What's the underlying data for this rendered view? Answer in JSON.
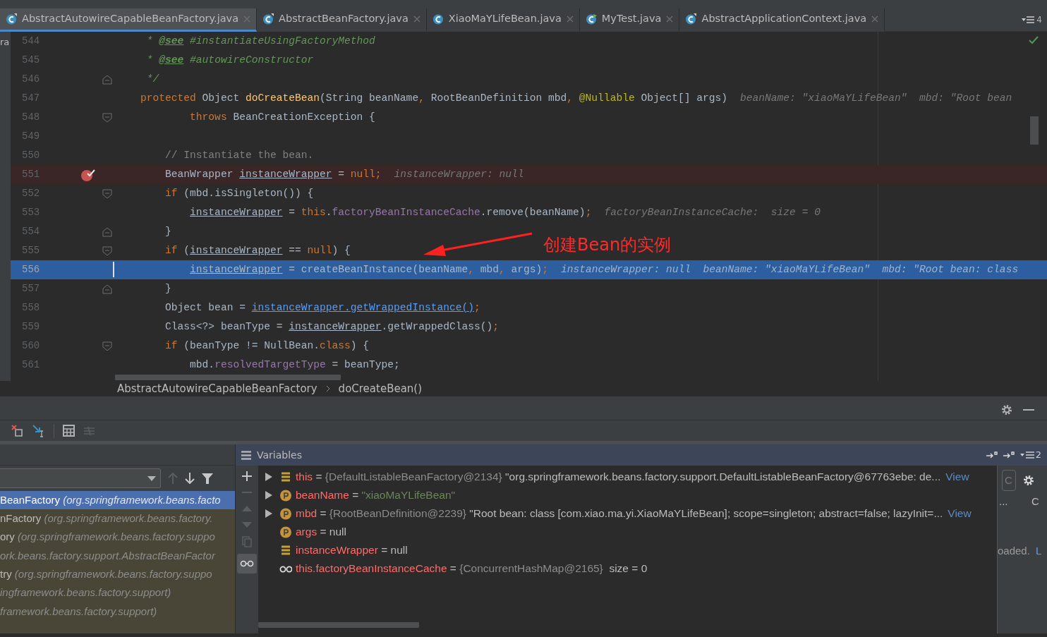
{
  "left_edge_text": "ra",
  "tabs": [
    {
      "label": "AbstractAutowireCapableBeanFactory.java",
      "kind": "abstract",
      "selected": true
    },
    {
      "label": "AbstractBeanFactory.java",
      "kind": "abstract",
      "selected": false
    },
    {
      "label": "XiaoMaYLifeBean.java",
      "kind": "class",
      "selected": false
    },
    {
      "label": "MyTest.java",
      "kind": "test",
      "selected": false
    },
    {
      "label": "AbstractApplicationContext.java",
      "kind": "abstract",
      "selected": false
    }
  ],
  "tab_count": "4",
  "editor": {
    "lines": [
      {
        "number": "544",
        "segments": [
          {
            "kind": "doc",
            "t": "     * "
          },
          {
            "kind": "tag",
            "t": "@see"
          },
          {
            "kind": "doc",
            "t": " #instantiateUsingFactoryMethod"
          }
        ]
      },
      {
        "number": "545",
        "segments": [
          {
            "kind": "doc",
            "t": "     * "
          },
          {
            "kind": "tag",
            "t": "@see"
          },
          {
            "kind": "doc",
            "t": " #autowireConstructor"
          }
        ]
      },
      {
        "number": "546",
        "fold_end": true,
        "segments": [
          {
            "kind": "doc",
            "t": "     */"
          }
        ]
      },
      {
        "number": "547",
        "segments": [
          {
            "kind": "kw",
            "t": "    protected "
          },
          {
            "kind": "plain",
            "t": "Object "
          },
          {
            "kind": "fn",
            "t": "doCreateBean"
          },
          {
            "kind": "plain",
            "t": "(String beanName"
          },
          {
            "kind": "kw",
            "t": ", "
          },
          {
            "kind": "plain",
            "t": "RootBeanDefinition mbd"
          },
          {
            "kind": "kw",
            "t": ", "
          },
          {
            "kind": "ann",
            "t": "@Nullable "
          },
          {
            "kind": "plain",
            "t": "Object[] args)"
          }
        ],
        "hint": "beanName: \"xiaoMaYLifeBean\"  mbd: \"Root bean"
      },
      {
        "number": "548",
        "fold_start": true,
        "segments": [
          {
            "kind": "kw",
            "t": "            throws "
          },
          {
            "kind": "plain",
            "t": "BeanCreationException {"
          }
        ]
      },
      {
        "number": "549"
      },
      {
        "number": "550",
        "segments": [
          {
            "kind": "cm",
            "t": "        // Instantiate the bean."
          }
        ]
      },
      {
        "number": "551",
        "breakpoint": true,
        "segments": [
          {
            "kind": "plain",
            "t": "        BeanWrapper "
          },
          {
            "kind": "ul",
            "t": "instanceWrapper"
          },
          {
            "kind": "plain",
            "t": " = "
          },
          {
            "kind": "kw",
            "t": "null;"
          }
        ],
        "hint": "instanceWrapper: null"
      },
      {
        "number": "552",
        "fold_start": true,
        "segments": [
          {
            "kind": "kw",
            "t": "        if "
          },
          {
            "kind": "plain",
            "t": "(mbd.isSingleton()) {"
          }
        ]
      },
      {
        "number": "553",
        "segments": [
          {
            "kind": "ul",
            "t": "            instanceWrapper"
          },
          {
            "kind": "plain",
            "t": " = "
          },
          {
            "kind": "kw",
            "t": "this"
          },
          {
            "kind": "plain",
            "t": "."
          },
          {
            "kind": "field",
            "t": "factoryBeanInstanceCache"
          },
          {
            "kind": "plain",
            "t": ".remove(beanName)"
          },
          {
            "kind": "kw",
            "t": ";"
          }
        ],
        "hint": "factoryBeanInstanceCache:  size = 0"
      },
      {
        "number": "554",
        "fold_end": true,
        "segments": [
          {
            "kind": "plain",
            "t": "        }"
          }
        ]
      },
      {
        "number": "555",
        "fold_start": true,
        "segments": [
          {
            "kind": "kw",
            "t": "        if "
          },
          {
            "kind": "plain",
            "t": "("
          },
          {
            "kind": "ul",
            "t": "instanceWrapper"
          },
          {
            "kind": "plain",
            "t": " == "
          },
          {
            "kind": "kw",
            "t": "null"
          },
          {
            "kind": "plain",
            "t": ") {"
          }
        ]
      },
      {
        "number": "556",
        "current": true,
        "segments": [
          {
            "kind": "ul",
            "t": "            instanceWrapper"
          },
          {
            "kind": "plain",
            "t": " = createBeanInstance(beanName"
          },
          {
            "kind": "kw",
            "t": ", "
          },
          {
            "kind": "plain",
            "t": "mbd"
          },
          {
            "kind": "kw",
            "t": ", "
          },
          {
            "kind": "plain",
            "t": "args)"
          },
          {
            "kind": "kw",
            "t": ";"
          }
        ],
        "hint": "instanceWrapper: null  beanName: \"xiaoMaYLifeBean\"  mbd: \"Root bean: class"
      },
      {
        "number": "557",
        "fold_end": true,
        "segments": [
          {
            "kind": "plain",
            "t": "        }"
          }
        ]
      },
      {
        "number": "558",
        "segments": [
          {
            "kind": "plain",
            "t": "        Object bean = "
          },
          {
            "kind": "link",
            "t": "instanceWrapper.getWrappedInstance()"
          },
          {
            "kind": "kw",
            "t": ";"
          }
        ]
      },
      {
        "number": "559",
        "segments": [
          {
            "kind": "plain",
            "t": "        Class<?> beanType = "
          },
          {
            "kind": "ul",
            "t": "instanceWrapper"
          },
          {
            "kind": "plain",
            "t": ".getWrappedClass()"
          },
          {
            "kind": "kw",
            "t": ";"
          }
        ]
      },
      {
        "number": "560",
        "fold_start": true,
        "segments": [
          {
            "kind": "kw",
            "t": "        if "
          },
          {
            "kind": "plain",
            "t": "(beanType != NullBean."
          },
          {
            "kind": "kw",
            "t": "class"
          },
          {
            "kind": "plain",
            "t": ") {"
          }
        ]
      },
      {
        "number": "561",
        "segments": [
          {
            "kind": "plain",
            "t": "            mbd."
          },
          {
            "kind": "field",
            "t": "resolvedTargetType"
          },
          {
            "kind": "plain",
            "t": " = beanType;"
          }
        ]
      }
    ],
    "annotation": "创建Bean的实例"
  },
  "breadcrumb": [
    "AbstractAutowireCapableBeanFactory",
    "doCreateBean()"
  ],
  "frames": [
    {
      "method": "BeanFactory",
      "location": "(org.springframework.beans.facto",
      "selected": true
    },
    {
      "method": "nFactory",
      "location": "(org.springframework.beans.factory.",
      "selected": false
    },
    {
      "method": "ory",
      "location": "(org.springframework.beans.factory.suppo",
      "selected": false
    },
    {
      "location": "ork.beans.factory.support.AbstractBeanFactor",
      "selected": false
    },
    {
      "method": "try",
      "location": "(org.springframework.beans.factory.suppo",
      "selected": false
    },
    {
      "location": "ingframework.beans.factory.support)",
      "selected": false
    },
    {
      "location": "framework.beans.factory.support)",
      "selected": false
    }
  ],
  "variables_title": "Variables",
  "variables_count": "2",
  "variables": [
    {
      "expandable": true,
      "kind": "field",
      "name": "this",
      "operator": "=",
      "ref": "{DefaultListableBeanFactory@2134}",
      "value": "\"org.springframework.beans.factory.support.DefaultListableBeanFactory@67763ebe: de...",
      "link": "View"
    },
    {
      "expandable": true,
      "kind": "param",
      "name": "beanName",
      "operator": "=",
      "value": "\"xiaoMaYLifeBean\"",
      "quoted_string": true
    },
    {
      "expandable": true,
      "kind": "param",
      "name": "mbd",
      "operator": "=",
      "ref": "{RootBeanDefinition@2239}",
      "value": "\"Root bean: class [com.xiao.ma.yi.XiaoMaYLifeBean]; scope=singleton; abstract=false; lazyInit=...",
      "link": "View"
    },
    {
      "expandable": false,
      "kind": "param",
      "name": "args",
      "operator": "=",
      "value": "null"
    },
    {
      "expandable": false,
      "kind": "field",
      "name": "instanceWrapper",
      "operator": "=",
      "value": "null"
    },
    {
      "expandable": false,
      "kind": "watch",
      "name": "this.factoryBeanInstanceCache",
      "operator": "=",
      "ref": "{ConcurrentHashMap@2165}",
      "value": " size = 0"
    }
  ],
  "side_panel": {
    "field_text": "C",
    "column_1": "...",
    "column_2": "C",
    "message": "oaded.",
    "link": "L"
  }
}
